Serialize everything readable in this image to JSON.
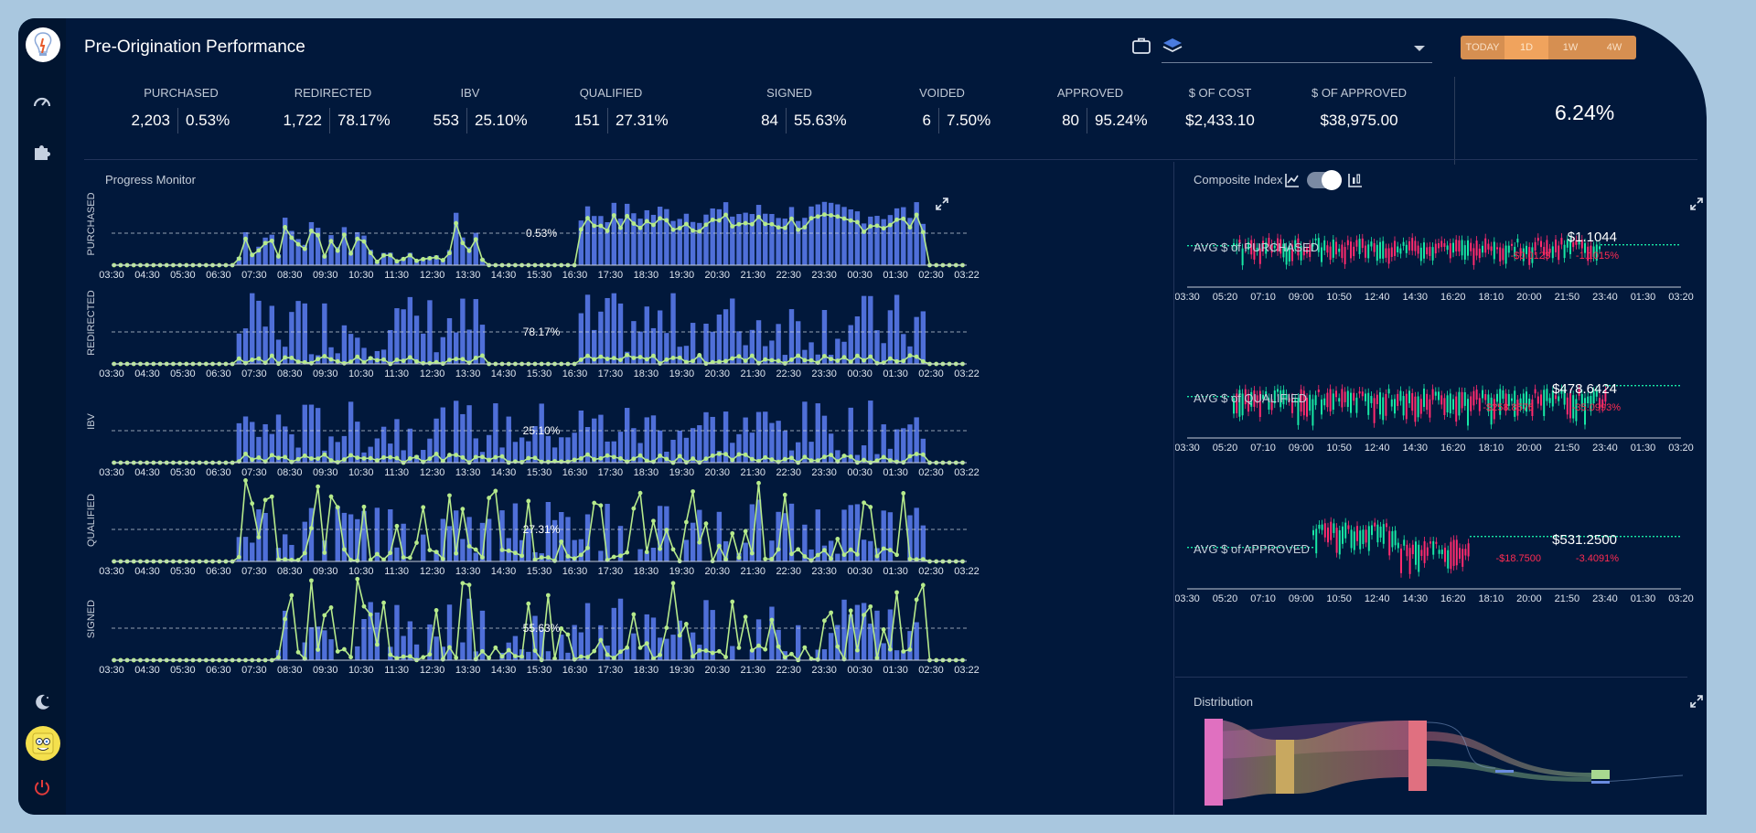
{
  "app": {
    "title": "Pre-Origination Performance"
  },
  "sidebar": {
    "items": [
      {
        "name": "dashboard",
        "icon": "speedometer-icon"
      },
      {
        "name": "plugins",
        "icon": "puzzle-icon"
      }
    ],
    "bottom": [
      {
        "name": "theme",
        "icon": "moon-icon"
      },
      {
        "name": "avatar",
        "icon": "avatar-icon"
      },
      {
        "name": "logout",
        "icon": "power-icon"
      }
    ]
  },
  "header": {
    "select_value": "",
    "ranges": [
      {
        "label": "TODAY",
        "active": false
      },
      {
        "label": "1D",
        "active": true
      },
      {
        "label": "1W",
        "active": false
      },
      {
        "label": "4W",
        "active": false
      }
    ]
  },
  "kpis": [
    {
      "label": "PURCHASED",
      "count": "2,203",
      "pct": "0.53%"
    },
    {
      "label": "REDIRECTED",
      "count": "1,722",
      "pct": "78.17%"
    },
    {
      "label": "IBV",
      "count": "553",
      "pct": "25.10%"
    },
    {
      "label": "QUALIFIED",
      "count": "151",
      "pct": "27.31%"
    },
    {
      "label": "SIGNED",
      "count": "84",
      "pct": "55.63%"
    },
    {
      "label": "VOIDED",
      "count": "6",
      "pct": "7.50%"
    },
    {
      "label": "APPROVED",
      "count": "80",
      "pct": "95.24%"
    },
    {
      "label": "$ OF COST",
      "value": "$2,433.10"
    },
    {
      "label": "$ OF APPROVED",
      "value": "$38,975.00"
    }
  ],
  "overall_rate": "6.24%",
  "progress_monitor": {
    "title": "Progress Monitor",
    "x_ticks": [
      "03:30",
      "04:30",
      "05:30",
      "06:30",
      "07:30",
      "08:30",
      "09:30",
      "10:30",
      "11:30",
      "12:30",
      "13:30",
      "14:30",
      "15:30",
      "16:30",
      "17:30",
      "18:30",
      "19:30",
      "20:30",
      "21:30",
      "22:30",
      "23:30",
      "00:30",
      "01:30",
      "02:30",
      "03:22"
    ],
    "rows": [
      {
        "label": "PURCHASED",
        "ref": "0.53%"
      },
      {
        "label": "REDIRECTED",
        "ref": "78.17%"
      },
      {
        "label": "IBV",
        "ref": "25.10%"
      },
      {
        "label": "QUALIFIED",
        "ref": "27.31%"
      },
      {
        "label": "SIGNED",
        "ref": "55.63%"
      }
    ]
  },
  "composite_index": {
    "title": "Composite Index",
    "x_ticks": [
      "03:30",
      "05:20",
      "07:10",
      "09:00",
      "10:50",
      "12:40",
      "14:30",
      "16:20",
      "18:10",
      "20:00",
      "21:50",
      "23:40",
      "01:30",
      "03:20"
    ],
    "series": [
      {
        "label": "AVG $ of PURCHASED",
        "value": "$1.1044",
        "change": "-$0.0123",
        "change_pct": "-1.1015%"
      },
      {
        "label": "AVG $ of QUALIFIED",
        "value": "$478.6424",
        "change": "-$258.8576",
        "change_pct": "-35.0993%"
      },
      {
        "label": "AVG $ of APPROVED",
        "value": "$531.2500",
        "change": "-$18.7500",
        "change_pct": "-3.4091%"
      }
    ]
  },
  "distribution": {
    "title": "Distribution"
  },
  "colors": {
    "bar": "#4f6fd8",
    "line": "#b6ea8b",
    "up": "#17e8a5",
    "down": "#ff2b6e",
    "accent": "#f0a35d"
  }
}
